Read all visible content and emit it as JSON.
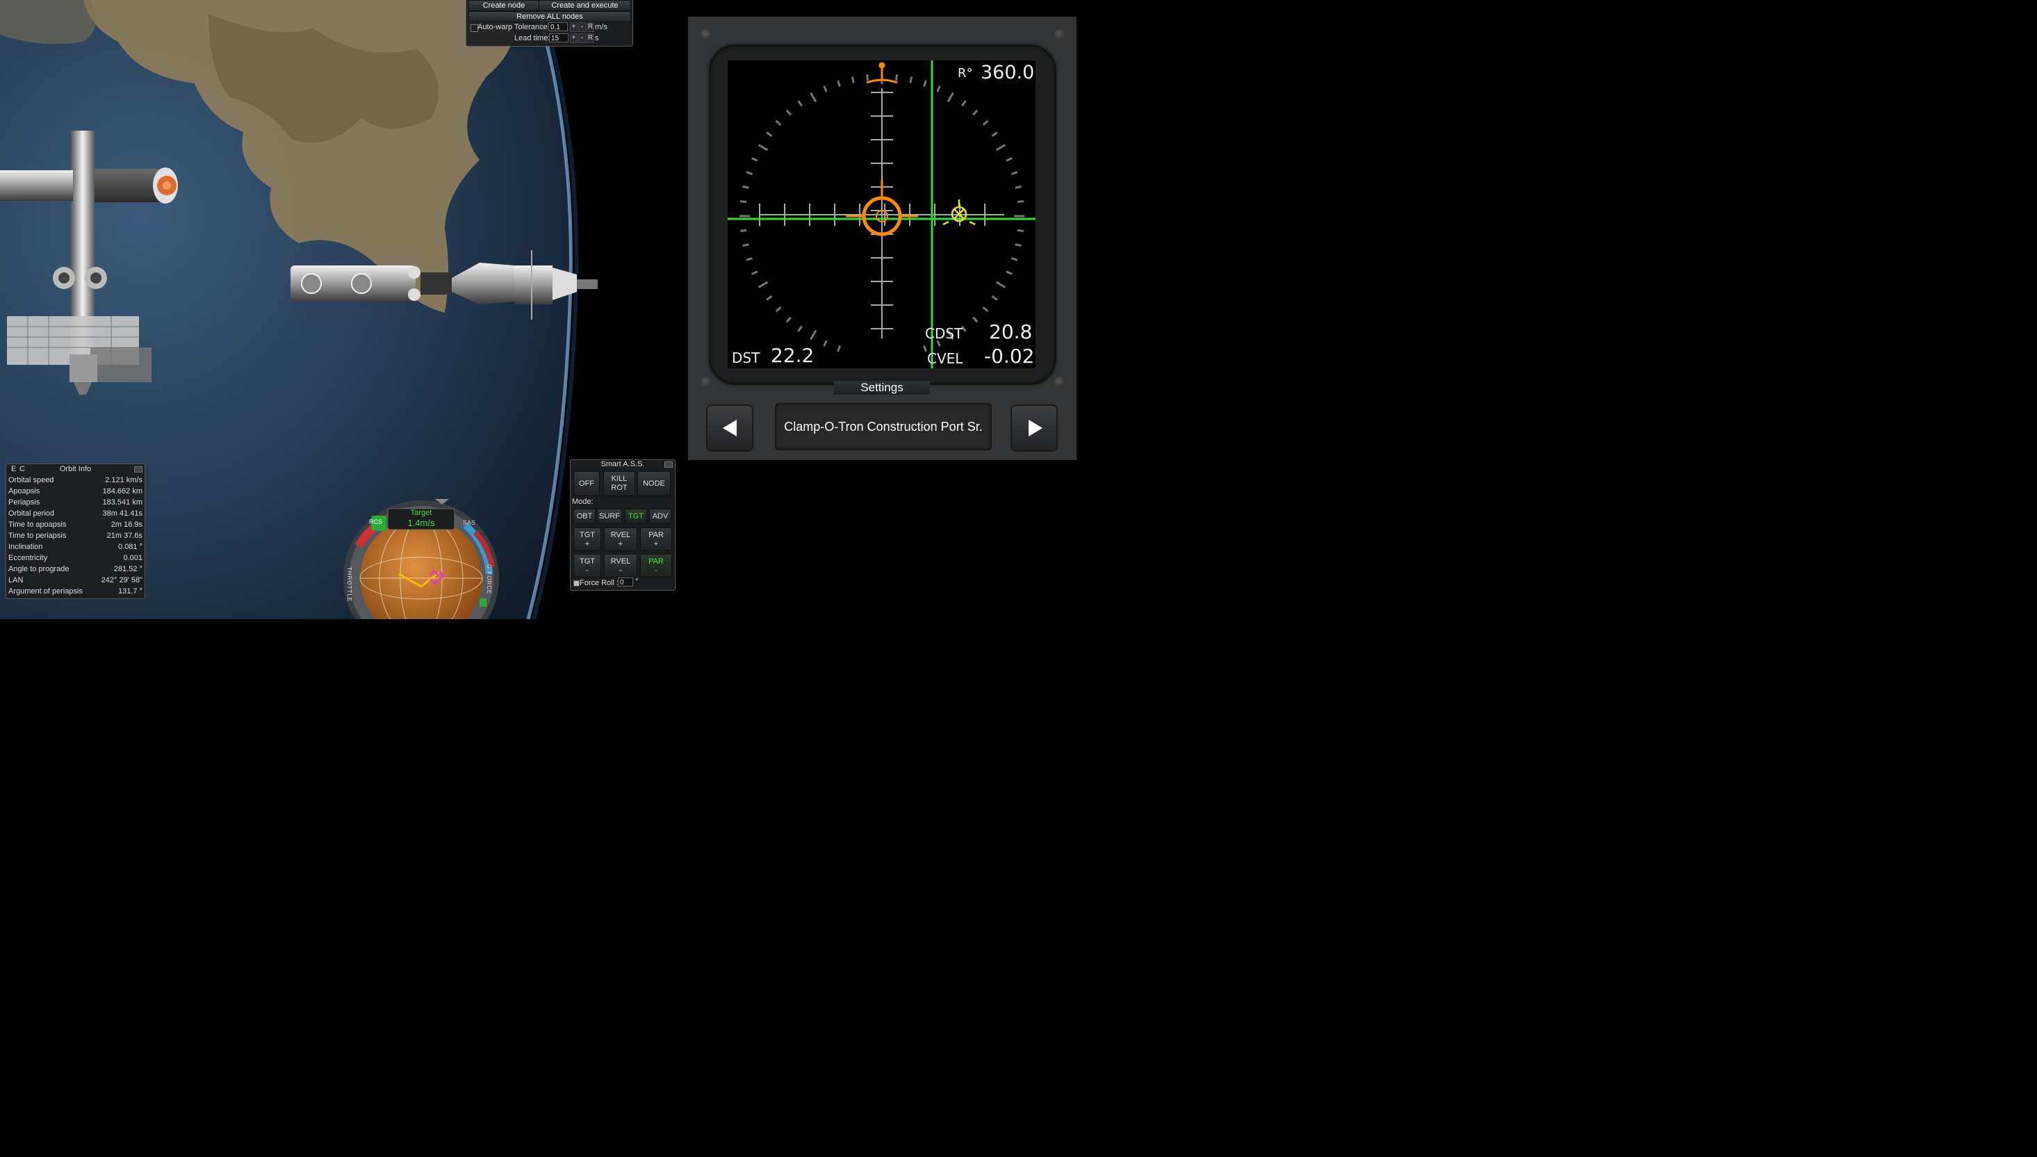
{
  "maneuver": {
    "create_node": "Create node",
    "create_execute": "Create and execute",
    "remove_all": "Remove ALL nodes",
    "autowarp_label": "Auto-warp",
    "tolerance_label": "Tolerance:",
    "tolerance_value": "0.1",
    "tolerance_unit": "m/s",
    "leadtime_label": "Lead time:",
    "leadtime_value": "15",
    "leadtime_unit": "s",
    "plus": "+",
    "minus": "-",
    "reset": "R"
  },
  "docking": {
    "r_label": "R°",
    "r_value": "360.0",
    "dst_label": "DST",
    "dst_value": "22.2",
    "cdst_label": "CDST",
    "cdst_value": "20.8",
    "cvel_label": "CVEL",
    "cvel_value": "-0.02",
    "settings_label": "Settings",
    "port_name": "Clamp-O-Tron Construction Port Sr.",
    "accent_green": "#33dd33",
    "accent_orange": "#ff8c00"
  },
  "orbit_info": {
    "tab_e": "E",
    "tab_c": "C",
    "title": "Orbit Info",
    "rows": [
      {
        "label": "Orbital speed",
        "value": "2.121 km/s"
      },
      {
        "label": "Apoapsis",
        "value": "184.662 km"
      },
      {
        "label": "Periapsis",
        "value": "183.541 km"
      },
      {
        "label": "Orbital period",
        "value": "38m 41.41s"
      },
      {
        "label": "Time to apoapsis",
        "value": "2m 16.9s"
      },
      {
        "label": "Time to periapsis",
        "value": "21m 37.6s"
      },
      {
        "label": "Inclination",
        "value": "0.081 °"
      },
      {
        "label": "Eccentricity",
        "value": "0.001"
      },
      {
        "label": "Angle to prograde",
        "value": "281.52 °"
      },
      {
        "label": "LAN",
        "value": "242° 29' 58\""
      },
      {
        "label": "Argument of periapsis",
        "value": "131.7 °"
      }
    ]
  },
  "smart_ass": {
    "title": "Smart A.S.S.",
    "off": "OFF",
    "kill_rot_1": "KILL",
    "kill_rot_2": "ROT",
    "node": "NODE",
    "mode_label": "Mode:",
    "modes": [
      "OBT",
      "SURF",
      "TGT",
      "ADV"
    ],
    "active_mode": "TGT",
    "dir_buttons": [
      {
        "top": "TGT",
        "bottom": "+"
      },
      {
        "top": "RVEL",
        "bottom": "+"
      },
      {
        "top": "PAR",
        "bottom": "+"
      },
      {
        "top": "TGT",
        "bottom": "-"
      },
      {
        "top": "RVEL",
        "bottom": "-"
      },
      {
        "top": "PAR",
        "bottom": "-"
      }
    ],
    "active_dir": "PAR -",
    "force_roll_label": "Force Roll :",
    "force_roll_value": "0",
    "force_roll_unit": "°"
  },
  "navball": {
    "speed_mode": "Target",
    "speed_value": "1.4m/s",
    "rcs_label": "RCS",
    "sas_label": "SAS",
    "throttle_label": "THROTTLE",
    "gforce_label": "G FORCE"
  }
}
